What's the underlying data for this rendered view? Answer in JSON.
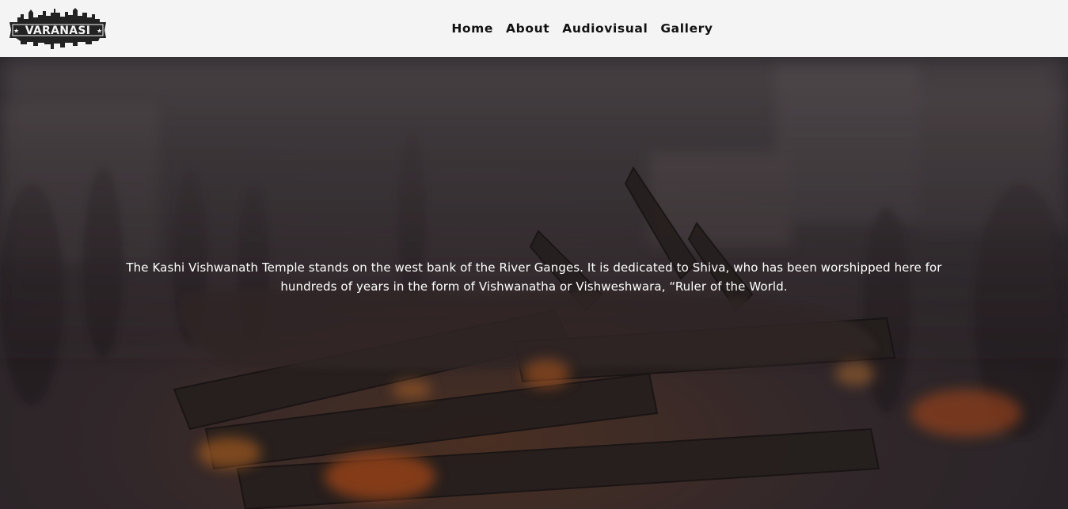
{
  "header": {
    "logo_text": "VARANASI",
    "nav": [
      {
        "label": "Home"
      },
      {
        "label": "About"
      },
      {
        "label": "Audiovisual"
      },
      {
        "label": "Gallery"
      }
    ]
  },
  "hero": {
    "caption_line_1": "The Kashi Vishwanath Temple stands on the west bank of the River Ganges. It is dedicated to Shiva, who has been worshipped here for",
    "caption_line_2": "hundreds of years in the form of Vishwanatha or Vishweshwara, “Ruler of the World."
  },
  "colors": {
    "header_bg": "#f4f4f4",
    "nav_text": "#111111",
    "caption_text": "#ffffff",
    "logo_dark": "#222222"
  }
}
